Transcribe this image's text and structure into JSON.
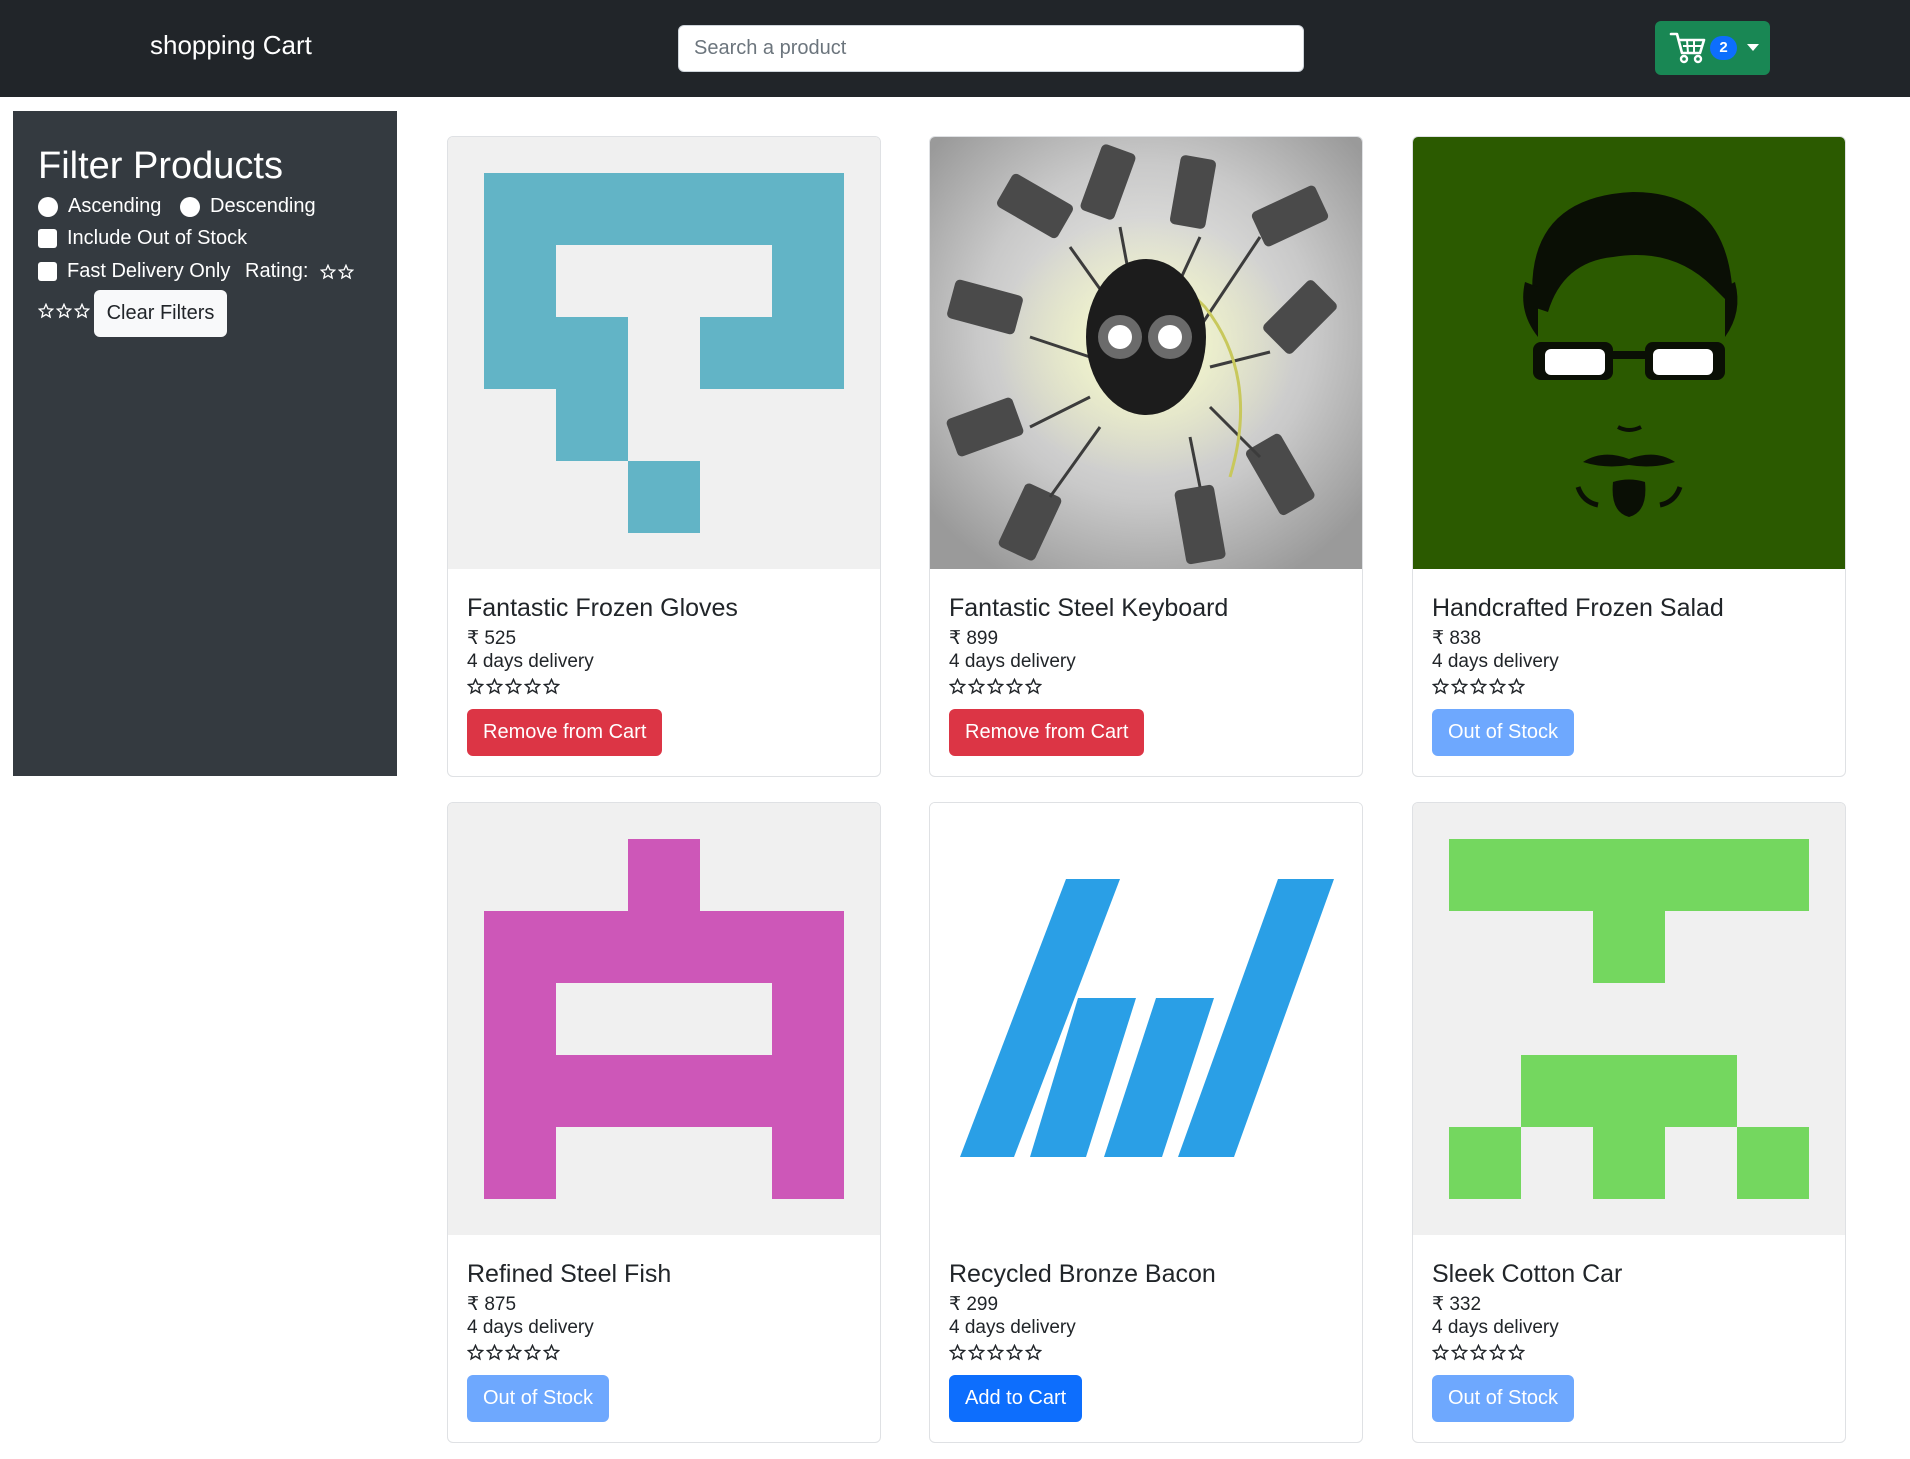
{
  "navbar": {
    "brand": "shopping Cart",
    "search_placeholder": "Search a product",
    "cart_count": "2",
    "cart_icon": "shopping-cart-icon",
    "cart_color": "#198754"
  },
  "filters": {
    "title": "Filter Products",
    "ascending_label": "Ascending",
    "descending_label": "Descending",
    "out_of_stock_label": "Include Out of Stock",
    "fast_delivery_label": "Fast Delivery Only",
    "rating_label": "Rating:",
    "clear_label": "Clear Filters"
  },
  "products": [
    {
      "name": "Fantastic Frozen Gloves",
      "price": "₹ 525",
      "delivery": "4 days delivery",
      "rating": 0,
      "action": "Remove from Cart",
      "action_style": "danger",
      "image": "teal-pixel-avatar"
    },
    {
      "name": "Fantastic Steel Keyboard",
      "price": "₹ 899",
      "delivery": "4 days delivery",
      "rating": 0,
      "action": "Remove from Cart",
      "action_style": "danger",
      "image": "robot-head-cameras"
    },
    {
      "name": "Handcrafted Frozen Salad",
      "price": "₹ 838",
      "delivery": "4 days delivery",
      "rating": 0,
      "action": "Out of Stock",
      "action_style": "disabled",
      "image": "green-face-glasses"
    },
    {
      "name": "Refined Steel Fish",
      "price": "₹ 875",
      "delivery": "4 days delivery",
      "rating": 0,
      "action": "Out of Stock",
      "action_style": "disabled",
      "image": "magenta-pixel-avatar"
    },
    {
      "name": "Recycled Bronze Bacon",
      "price": "₹ 299",
      "delivery": "4 days delivery",
      "rating": 0,
      "action": "Add to Cart",
      "action_style": "primary",
      "image": "blue-stripes-logo"
    },
    {
      "name": "Sleek Cotton Car",
      "price": "₹ 332",
      "delivery": "4 days delivery",
      "rating": 0,
      "action": "Out of Stock",
      "action_style": "disabled",
      "image": "green-pixel-avatar"
    }
  ]
}
